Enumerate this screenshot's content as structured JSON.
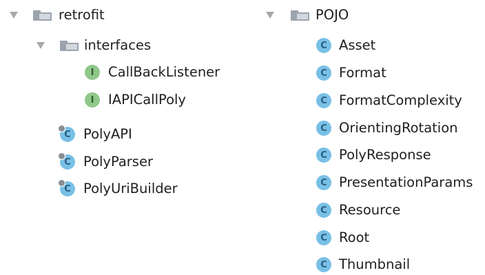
{
  "left_tree": {
    "root_label": "retrofit",
    "folder_label": "interfaces",
    "interfaces": [
      "CallBackListener",
      "IAPICallPoly"
    ],
    "classes": [
      "PolyAPI",
      "PolyParser",
      "PolyUriBuilder"
    ]
  },
  "right_tree": {
    "root_label": "POJO",
    "classes": [
      "Asset",
      "Format",
      "FormatComplexity",
      "OrientingRotation",
      "PolyResponse",
      "PresentationParams",
      "Resource",
      "Root",
      "Thumbnail"
    ]
  },
  "badges": {
    "class_letter": "C",
    "interface_letter": "I"
  },
  "icons": {
    "expand": "chevron-down-icon",
    "package": "package-folder-icon",
    "class": "class-icon",
    "interface": "interface-icon"
  },
  "colors": {
    "class_badge": "#79c0e6",
    "interface_badge": "#8fc88a",
    "folder": "#9ba3ad",
    "arrow": "#a9a9a9"
  }
}
